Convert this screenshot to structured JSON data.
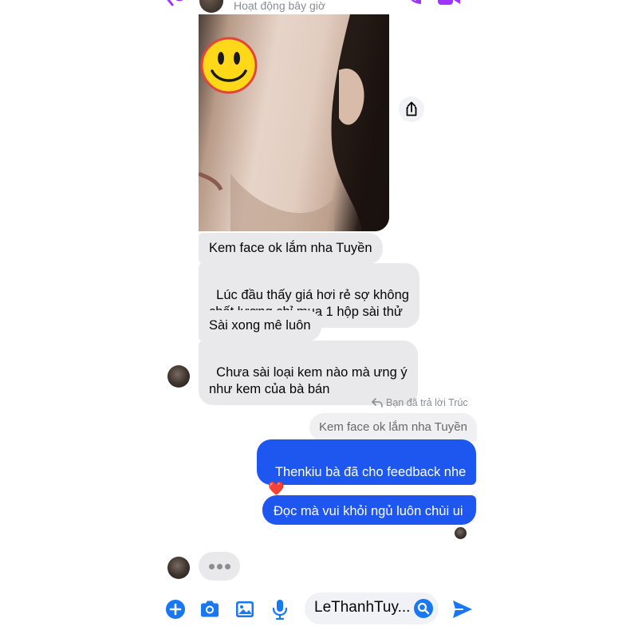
{
  "header": {
    "status": "Hoạt động bây giờ"
  },
  "conversation": {
    "incoming": [
      {
        "text": "Kem face ok lắm nha Tuyền"
      },
      {
        "text": "Lúc đầu thấy giá hơi rẻ sợ không\nchất lượng chỉ mua 1 hộp sài thử"
      },
      {
        "text": "Sài xong mê luôn"
      },
      {
        "text": "Chưa sài loại kem nào mà ưng ý\nnhư kem của bà bán"
      }
    ],
    "reply_label": "Bạn đã trả lời Trúc",
    "quoted_message": "Kem face ok lắm nha Tuyền",
    "outgoing": [
      {
        "text": "Thenkiu bà đã cho feedback nhe\n❤️"
      },
      {
        "text": "Đọc mà vui khỏi ngủ luôn chùi ui"
      }
    ]
  },
  "composer": {
    "search_value": "LeThanhTuy...",
    "icons": [
      "plus-icon",
      "camera-icon",
      "image-icon",
      "microphone-icon",
      "search-icon",
      "send-icon"
    ]
  },
  "colors": {
    "outgoing_bubble": "#1e57f0",
    "incoming_bubble": "#e9e9eb",
    "accent": "#1877f2",
    "header_icons": "#a033ff"
  }
}
